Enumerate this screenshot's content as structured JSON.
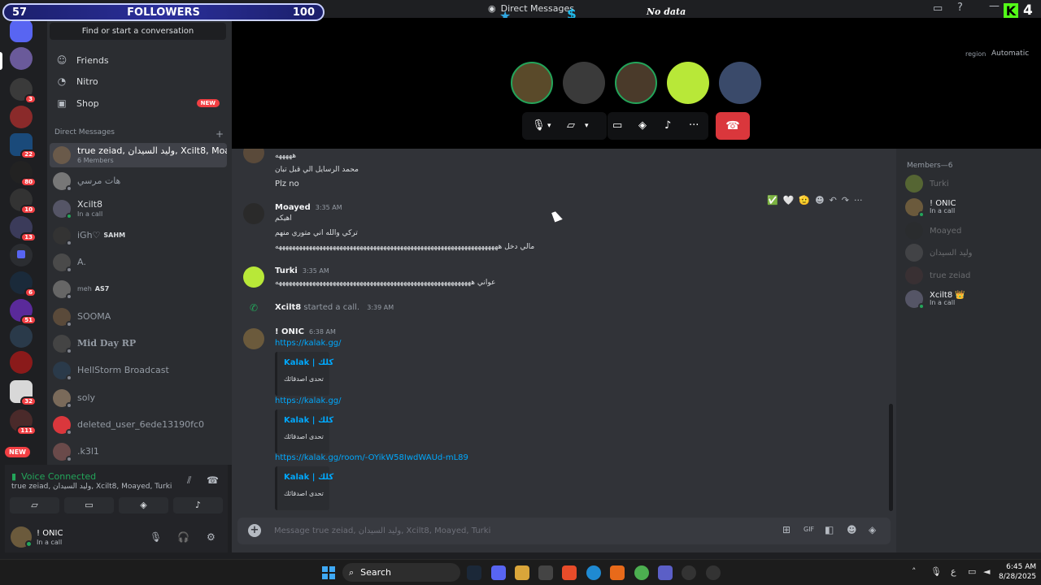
{
  "overlay": {
    "left_count": "57",
    "label": "FOLLOWERS",
    "right_count": "100",
    "no_data": "No data",
    "kick_count": "4"
  },
  "window": {
    "title": "Direct Messages"
  },
  "sidebar": {
    "search": "Find or start a conversation",
    "nav": [
      {
        "label": "Friends"
      },
      {
        "label": "Nitro"
      },
      {
        "label": "Shop",
        "badge": "NEW"
      }
    ],
    "dm_header": "Direct Messages",
    "dm_add": "+",
    "dms": [
      {
        "name": "true zeiad, وليد السيدان, Xcilt8, Moaye...",
        "sub": "6 Members",
        "active": true
      },
      {
        "name": "هات مرسي",
        "sub": ""
      },
      {
        "name": "Xcilt8",
        "sub": "In a call"
      },
      {
        "name": "iGh♡",
        "tag": "SAHM",
        "sub": ""
      },
      {
        "name": "A.",
        "sub": ""
      },
      {
        "name": "meh",
        "tag": "AS7",
        "sub": ""
      },
      {
        "name": "SOOMA",
        "sub": ""
      },
      {
        "name": "Mid Day RP",
        "sub": ""
      },
      {
        "name": "HellStorm Broadcast",
        "sub": ""
      },
      {
        "name": "soly",
        "sub": ""
      },
      {
        "name": "deleted_user_6ede13190fc0",
        "sub": ""
      },
      {
        "name": ".k3l1",
        "sub": ""
      }
    ]
  },
  "rail": {
    "badges": [
      "3",
      "22",
      "80",
      "10",
      "13",
      "6",
      "51",
      "32",
      "111"
    ],
    "new_label": "NEW"
  },
  "voice": {
    "status": "Voice Connected",
    "names": "true zeiad, وليد السيدان, Xcilt8, Moayed, Turki",
    "user_name": "! ONIC",
    "user_status": "In a call"
  },
  "call": {
    "region_label": "region",
    "region_value": "Automatic"
  },
  "chat": {
    "top_lines": [
      "هههههه",
      "محمد الرسايل الي قبل تبان",
      "Plz no"
    ],
    "messages": [
      {
        "author": "Moayed",
        "time": "3:35 AM",
        "lines": [
          "اهيكم",
          "تركي والله اني متوري منهم",
          "مالي دخل ههههههههههههههههههههههههههههههههههههههههههههههههههههههههههههههههههه"
        ]
      },
      {
        "author": "Turki",
        "time": "3:35 AM",
        "lines": [
          "عواني ههههههههههههههههههههههههههههههههههههههههههههههههههههههههههه"
        ]
      },
      {
        "author": "! ONIC",
        "time": "6:38 AM"
      }
    ],
    "system": {
      "author": "Xcilt8",
      "text": "started a call.",
      "time": "3:39 AM"
    },
    "links": [
      "https://kalak.gg/",
      "https://kalak.gg/",
      "https://kalak.gg/room/-OYikW58IwdWAUd-mL89"
    ],
    "embed": {
      "title": "Kalak | كلك",
      "desc": "تحدى اصدقائك"
    },
    "reactions": [
      "✅",
      "🤍",
      "🫡"
    ],
    "composer_placeholder": "Message true zeiad, وليد السيدان, Xcilt8, Moayed, Turki"
  },
  "members": {
    "header": "Members—6",
    "list": [
      {
        "name": "Turki",
        "sub": "",
        "online": false
      },
      {
        "name": "! ONIC",
        "sub": "In a call",
        "online": true
      },
      {
        "name": "Moayed",
        "sub": "",
        "online": false
      },
      {
        "name": "وليد السيدان",
        "sub": "",
        "online": false
      },
      {
        "name": "true zeiad",
        "sub": "",
        "online": false
      },
      {
        "name": "Xcilt8 👑",
        "sub": "In a call",
        "online": true
      }
    ]
  },
  "taskbar": {
    "search": "Search",
    "lang": "ع",
    "time": "6:45 AM",
    "date": "8/28/2025"
  }
}
